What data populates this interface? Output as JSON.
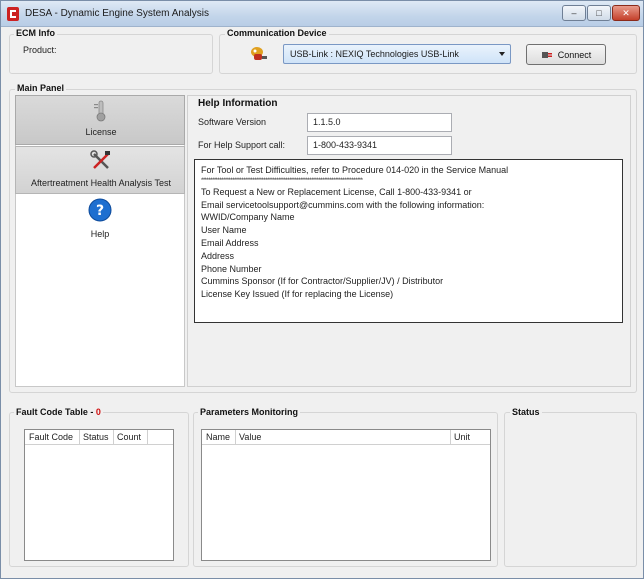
{
  "window": {
    "title": "DESA - Dynamic Engine System Analysis",
    "controls": {
      "minimize": "–",
      "maximize": "□",
      "close": "✕"
    }
  },
  "ecm_info": {
    "title": "ECM Info",
    "product_label": "Product:"
  },
  "communication": {
    "title": "Communication Device",
    "device_selected": "USB-Link : NEXIQ Technologies USB-Link",
    "connect_label": "Connect"
  },
  "main_panel": {
    "title": "Main Panel",
    "nav": [
      {
        "label": "License",
        "icon": "thermometer-icon"
      },
      {
        "label": "Aftertreatment Health Analysis Test",
        "icon": "tools-icon"
      },
      {
        "label": "Help",
        "icon": "help-icon"
      }
    ]
  },
  "help_info": {
    "title": "Help Information",
    "software_version_label": "Software Version",
    "software_version_value": "1.1.5.0",
    "support_label": "For Help Support call:",
    "support_value": "1-800-433-9341",
    "lines": [
      "For Tool or Test Difficulties, refer to Procedure 014-020 in the Service Manual",
      "****************************************************************************************",
      "To Request a New or Replacement License, Call 1-800-433-9341 or",
      "Email servicetoolsupport@cummins.com with the following information:",
      "WWID/Company Name",
      "User Name",
      "Email Address",
      "Address",
      "Phone Number",
      "Cummins Sponsor (If for Contractor/Supplier/JV) / Distributor",
      "License Key Issued (If for replacing the License)"
    ]
  },
  "fault_code_table": {
    "title": "Fault Code Table - ",
    "count": "0",
    "columns": [
      "Fault Code",
      "Status",
      "Count"
    ]
  },
  "parameters_monitoring": {
    "title": "Parameters Monitoring",
    "columns": [
      "Name",
      "Value",
      "Unit"
    ]
  },
  "status": {
    "title": "Status"
  },
  "colors": {
    "accent": "#c22222",
    "help_blue": "#1e6fd0",
    "count_red": "#d01010"
  }
}
